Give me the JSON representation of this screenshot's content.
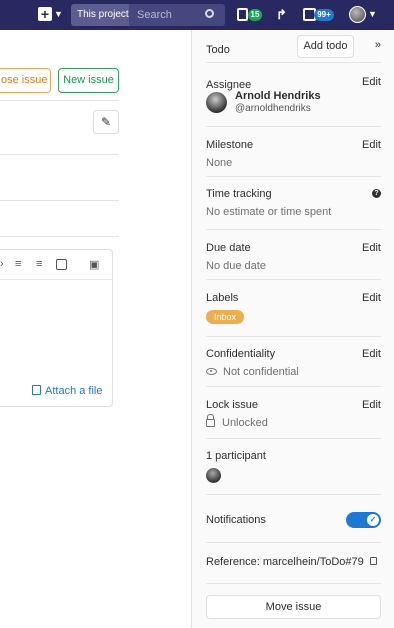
{
  "topbar": {
    "scope_label": "This project",
    "search_placeholder": "Search",
    "issues_count": "15",
    "todos_count": "99+"
  },
  "main": {
    "close_issue_label": "ose issue",
    "new_issue_label": "New issue",
    "attach_file_label": "Attach a file"
  },
  "sidebar": {
    "todo_label": "Todo",
    "add_todo_label": "Add todo",
    "assignee": {
      "label": "Assignee",
      "edit": "Edit",
      "name": "Arnold Hendriks",
      "username": "@arnoldhendriks"
    },
    "milestone": {
      "label": "Milestone",
      "edit": "Edit",
      "value": "None"
    },
    "time_tracking": {
      "label": "Time tracking",
      "value": "No estimate or time spent"
    },
    "due_date": {
      "label": "Due date",
      "edit": "Edit",
      "value": "No due date"
    },
    "labels": {
      "label": "Labels",
      "edit": "Edit",
      "badge": "Inbox"
    },
    "confidentiality": {
      "label": "Confidentiality",
      "edit": "Edit",
      "value": "Not confidential"
    },
    "lock_issue": {
      "label": "Lock issue",
      "edit": "Edit",
      "value": "Unlocked"
    },
    "participants": {
      "label": "1 participant"
    },
    "notifications": {
      "label": "Notifications",
      "enabled": true
    },
    "reference": {
      "label": "Reference: marcelhein/ToDo#79"
    },
    "move_issue_label": "Move issue"
  },
  "colors": {
    "topbar_bg": "#292961",
    "accent_blue": "#1f78d1",
    "close_orange": "#e67a17",
    "new_green": "#1e9a4a",
    "inbox_badge": "#f0ad4e",
    "issues_badge": "#1aaa55"
  }
}
